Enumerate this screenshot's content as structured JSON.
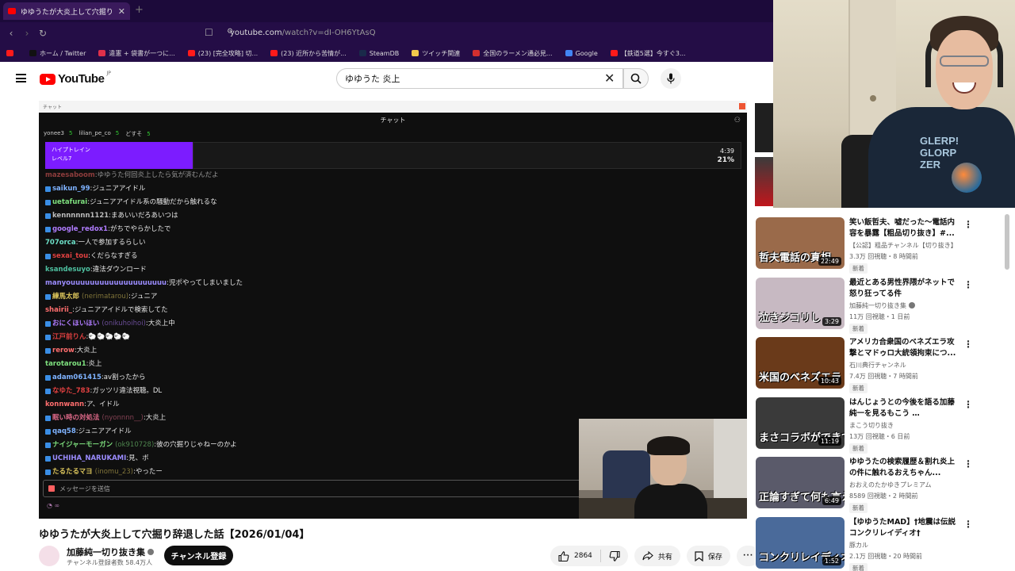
{
  "browser": {
    "tab_title": "ゆゆうたが大炎上して穴掘り辞退",
    "url_host": "youtube.com",
    "url_path": "/watch?v=dI-OH6YtAsQ",
    "bookmarks": [
      {
        "label": "",
        "color": "#ff1a1a"
      },
      {
        "label": "ホーム / Twitter",
        "color": "#111111"
      },
      {
        "label": "違憲 + 袋書が一つに...",
        "color": "#e0304a"
      },
      {
        "label": "(23) [完全攻略] 切...",
        "color": "#ff1a1a"
      },
      {
        "label": "(23) 近所から苦情が...",
        "color": "#ff1a1a"
      },
      {
        "label": "SteamDB",
        "color": "#1a2a4a"
      },
      {
        "label": "ツイッチ関連",
        "color": "#f2c94c"
      },
      {
        "label": "全国のラーメン通必見...",
        "color": "#d32f2f"
      },
      {
        "label": "Google",
        "color": "#4285f4"
      },
      {
        "label": "【鉄道5選】今すぐ3...",
        "color": "#ff1a1a"
      }
    ]
  },
  "header": {
    "logo_text": "YouTube",
    "logo_region": "JP",
    "search_value": "ゆゆうた 炎上"
  },
  "player": {
    "strip_label": "チャット",
    "chat_title": "チャット",
    "top_chatters": [
      {
        "name": "yonee3",
        "count": "5"
      },
      {
        "name": "lilian_pe_co",
        "count": "5"
      },
      {
        "name": "どすそ",
        "count": "5"
      }
    ],
    "hype_train": {
      "title": "ハイプトレイン",
      "level": "レベル7",
      "time": "4:39",
      "percent": "21%"
    },
    "chat": [
      {
        "user": "mazesaboom",
        "color": "#e05a5a",
        "msg": "ゆゆうた何回炎上したら気が済むんだよ",
        "badge": false,
        "faded": true
      },
      {
        "user": "saikun_99",
        "color": "#7fb3ff",
        "msg": "ジュニアアイドル",
        "badge": true
      },
      {
        "user": "uetafurai",
        "color": "#7ee07e",
        "msg": "ジュニアアイドル系の騒動だから触れるな",
        "badge": true
      },
      {
        "user": "kennnnnn1121",
        "color": "#bbbbbb",
        "msg": "まあいいだろあいつは",
        "badge": true
      },
      {
        "user": "google_redox1",
        "color": "#b07cff",
        "msg": "がちでやらかしたで",
        "badge": true
      },
      {
        "user": "707orca",
        "color": "#6de0c8",
        "msg": "一人で参加するらしい",
        "badge": false
      },
      {
        "user": "sexai_tou",
        "color": "#e04040",
        "msg": "くだらなすぎる",
        "badge": true
      },
      {
        "user": "ksandesuyo",
        "color": "#4ec0a0",
        "msg": "違法ダウンロード",
        "badge": false
      },
      {
        "user": "manyouuuuuuuuuuuuuuuuuuuu",
        "color": "#9b8cff",
        "msg": "児ポやってしまいました",
        "badge": false
      },
      {
        "user": "練馬太郎",
        "sub": "(nerimatarou)",
        "color": "#d9c35b",
        "msg": "ジュニア",
        "badge": true
      },
      {
        "user": "shairii_",
        "color": "#ff6e6e",
        "msg": "ジュニアアイドルで検索してた",
        "badge": false
      },
      {
        "user": "おにくほいほい",
        "sub": "(onikuhoihoi)",
        "color": "#b07cff",
        "msg": "大炎上中",
        "badge": true
      },
      {
        "user": "江戸前りん",
        "color": "#e04040",
        "msg": "🐑🐑🐑🐑🐑",
        "badge": true
      },
      {
        "user": "rerow",
        "color": "#ff6e6e",
        "msg": "大炎上",
        "badge": true
      },
      {
        "user": "tarotarou1",
        "color": "#7ee07e",
        "msg": "炎上",
        "badge": false
      },
      {
        "user": "adam061415",
        "color": "#7fb3ff",
        "msg": "av割ったから",
        "badge": true
      },
      {
        "user": "なゆた_783",
        "color": "#e04040",
        "msg": "ガッツリ違法視聴。DL",
        "badge": true
      },
      {
        "user": "konnwann",
        "color": "#ff6e6e",
        "msg": "ア、イドル",
        "badge": false
      },
      {
        "user": "眠い時の対処法",
        "sub": "(nyonnnn__)",
        "color": "#e06a8a",
        "msg": "大炎上",
        "badge": true
      },
      {
        "user": "qaq58",
        "color": "#7fb3ff",
        "msg": "ジュニアアイドル",
        "badge": true
      },
      {
        "user": "ナイジャーモーガン",
        "sub": "(ok910728)",
        "color": "#7ee07e",
        "msg": "彼の穴掘りじゃねーのかよ",
        "badge": true
      },
      {
        "user": "UCHIHA_NARUKAMI",
        "color": "#9b8cff",
        "msg": "見、ボ",
        "badge": true
      },
      {
        "user": "たるたるマヨ",
        "sub": "(inomu_23)",
        "color": "#d9c35b",
        "msg": "やったー",
        "badge": true
      }
    ],
    "input_placeholder": "メッセージを送信",
    "footer": "∞"
  },
  "video": {
    "title": "ゆゆうたが大炎上して穴掘り辞退した話【2026/01/04】",
    "channel": "加藤純一切り抜き集",
    "subscribers": "チャンネル登録者数 58.4万人",
    "subscribe_label": "チャンネル登録",
    "likes": "2864",
    "share_label": "共有",
    "save_label": "保存"
  },
  "webcam": {
    "shirt_text": "GLERP!\nGLORP\nZER"
  },
  "sidebar": {
    "recommendations": [
      {
        "title": "笑い飯哲夫、嘘だった〜電話内容を暴露【粗品切り抜き】#...",
        "channel": "【公認】粗品チャンネル【切り抜き】",
        "meta": "3.3万 回視聴・8 時間前",
        "badge": "新着",
        "duration": "22:49",
        "thumb_text": "哲夫電話の真相",
        "thumb_bg": "#9a6a4a",
        "verified": false
      },
      {
        "title": "最近とある男性界隈がネットで怒り狂ってる件【2026/01/03】",
        "channel": "加藤純一切り抜き集",
        "meta": "11万 回視聴・1 日前",
        "badge": "新着",
        "duration": "3:29",
        "thumb_text": "泣きジコリし",
        "thumb_bg": "#c7b9c2",
        "verified": true
      },
      {
        "title": "アメリカ合衆国のベネズエラ攻撃とマドゥロ大統領拘束につ...",
        "channel": "石川典行チャンネル",
        "meta": "7.4万 回視聴・7 時間前",
        "badge": "新着",
        "duration": "10:43",
        "thumb_text": "米国のベネズエラ",
        "thumb_bg": "#6a3a1a",
        "verified": false
      },
      {
        "title": "はんじょうとの今後を語る加藤純一を見るもこう …",
        "channel": "まこう切り抜き",
        "meta": "13万 回視聴・6 日前",
        "badge": "新着",
        "duration": "11:19",
        "thumb_text": "まさコラボができてい",
        "thumb_bg": "#3a3a3a",
        "verified": false
      },
      {
        "title": "ゆゆうたの検索履歴＆割れ炎上の件に触れるおえちゃん...",
        "channel": "おおえのたかゆきプレミアム",
        "meta": "8589 回視聴・2 時間前",
        "badge": "新着",
        "duration": "6:49",
        "thumb_text": "正論すぎて何も言えない",
        "thumb_bg": "#5a5a6a",
        "verified": false
      },
      {
        "title": "【ゆゆうたMAD】†地震は伝説コンクリレイディオ†",
        "channel": "豚カル",
        "meta": "2.1万 回視聴・20 時間前",
        "badge": "新着",
        "duration": "1:52",
        "thumb_text": "コンクリレイディオ",
        "thumb_bg": "#4a6a9a",
        "verified": false
      }
    ]
  }
}
